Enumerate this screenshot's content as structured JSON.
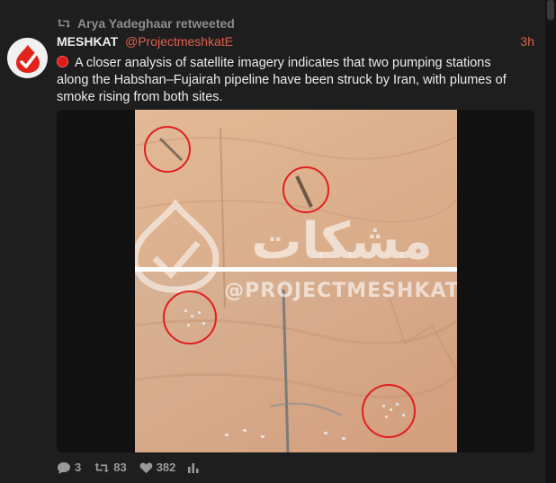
{
  "retweet": {
    "label": "Arya Yadeghaar retweeted",
    "icon": "retweet-icon"
  },
  "tweet": {
    "author_name": "MESHKAT",
    "author_handle": "@ProjectmeshkatE",
    "timestamp": "3h",
    "text": "A closer analysis of satellite imagery indicates that two pumping stations along the Habshan–Fujairah pipeline have been struck by Iran, with plumes of smoke rising from both sites.",
    "media": {
      "watermark_arabic": "مشكات",
      "watermark_handle": "@PROJECTMESHKAT",
      "highlight_circles": 4
    }
  },
  "actions": {
    "replies": "3",
    "retweets": "83",
    "likes": "382"
  },
  "colors": {
    "background": "#1e1e1e",
    "accent": "#e0604a",
    "alert_red": "#dd1a1a",
    "muted": "#8d8d8d"
  }
}
